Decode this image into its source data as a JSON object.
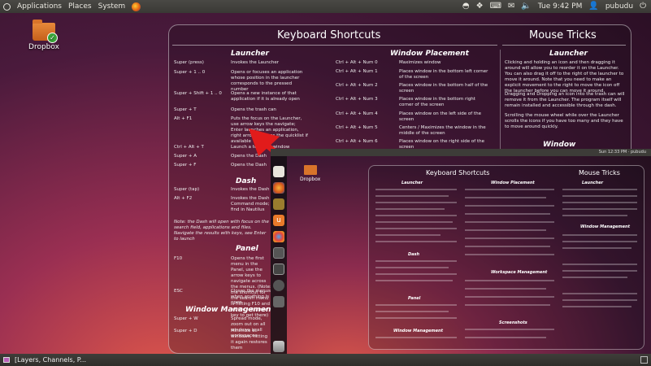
{
  "top_panel": {
    "menus": [
      "Applications",
      "Places",
      "System"
    ],
    "clock": "Tue 9:42 PM",
    "user": "pubudu"
  },
  "desktop": {
    "icon_label": "Dropbox"
  },
  "overlay": {
    "title_left": "Keyboard Shortcuts",
    "title_right": "Mouse Tricks",
    "launcher": {
      "heading": "Launcher",
      "rows": [
        {
          "key": "Super (press)",
          "desc": "Invokes the Launcher"
        },
        {
          "key": "Super + 1 .. 0",
          "desc": "Opens or focuses an application whose position in the launcher corresponds to the pressed number"
        },
        {
          "key": "Super + Shift + 1 .. 0",
          "desc": "Opens a new instance of that application if it is already open"
        },
        {
          "key": "Super + T",
          "desc": "Opens the trash can"
        },
        {
          "key": "Alt + F1",
          "desc": "Puts the focus on the Launcher, use arrow keys the navigate; Enter launches an application, right arrow exposes the quicklist if available"
        },
        {
          "key": "Ctrl + Alt + T",
          "desc": "Launch a terminal window"
        },
        {
          "key": "Super + A",
          "desc": "Opens the Dash"
        },
        {
          "key": "Super + F",
          "desc": "Opens the Dash"
        }
      ]
    },
    "dash": {
      "heading": "Dash",
      "rows": [
        {
          "key": "Super (tap)",
          "desc": "Invokes the Dash in"
        },
        {
          "key": "Alt + F2",
          "desc": "Invokes the Dash in Run Command mode; folder name will find in Nautilus"
        }
      ],
      "note": "Note: the Dash will open with focus on the search field, applications and files. Navigate the results with keys, see Enter to launch"
    },
    "panel": {
      "heading": "Panel",
      "rows": [
        {
          "key": "F10",
          "desc": "Opens the first menu in the Panel, use the arrow keys to navigate across the menus. (Note: the shortcut for the search menu is hitting F10 and let the left arrow key to get there)"
        },
        {
          "key": "ESC",
          "desc": "Closes the menus when anything is open"
        }
      ]
    },
    "window_management": {
      "heading": "Window Management",
      "heading_right": "Window Management",
      "rows": [
        {
          "key": "Super + W",
          "desc": "Spread mode, zoom out on all windows in all workspaces"
        },
        {
          "key": "Super + D",
          "desc": "Minimize all windows, hitting it again restores them"
        }
      ]
    },
    "window_placement": {
      "heading": "Window Placement",
      "rows": [
        {
          "key": "Ctrl + Alt + Num 0",
          "desc": "Maximizes window"
        },
        {
          "key": "Ctrl + Alt + Num 1",
          "desc": "Places window in the bottom left corner of the screen"
        },
        {
          "key": "Ctrl + Alt + Num 2",
          "desc": "Places window in the bottom half of the screen"
        },
        {
          "key": "Ctrl + Alt + Num 3",
          "desc": "Places window in the bottom right corner of the screen"
        },
        {
          "key": "Ctrl + Alt + Num 4",
          "desc": "Places window on the left side of the screen"
        },
        {
          "key": "Ctrl + Alt + Num 5",
          "desc": "Centers / Maximizes the window in the middle of the screen"
        },
        {
          "key": "Ctrl + Alt + Num 6",
          "desc": "Places window on the right side of the screen"
        }
      ]
    },
    "mouse_tricks": [
      "Clicking and holding an icon and then dragging it around will allow you to reorder it on the Launcher. You can also drag it off to the right of the launcher to move it around. Note that you need to make an explicit movement to the right to move the icon off the launcher before you can move it around.",
      "Dragging and Dropping an icon into the trash can will remove it from the Launcher. The program itself will remain installed and accessible through the dash.",
      "Scrolling the mouse wheel while over the Launcher scrolls the icons if you have too many and they have to move around quickly."
    ]
  },
  "second_screen": {
    "clock": "Sun 12:33 PM",
    "user": "pubudu",
    "icon_label": "Dropbox",
    "title_left": "Keyboard Shortcuts",
    "title_right": "Mouse Tricks",
    "sections": [
      "Launcher",
      "Window Placement",
      "Dash",
      "Workspace Management",
      "Panel",
      "Window Management",
      "Screenshots",
      "Launcher",
      "Window Management"
    ]
  },
  "bottom_panel": {
    "task_label": "[Layers, Channels, P..."
  },
  "colors": {
    "accent_arrow": "#e21b1b",
    "panel_bg": "#3c3b37"
  }
}
